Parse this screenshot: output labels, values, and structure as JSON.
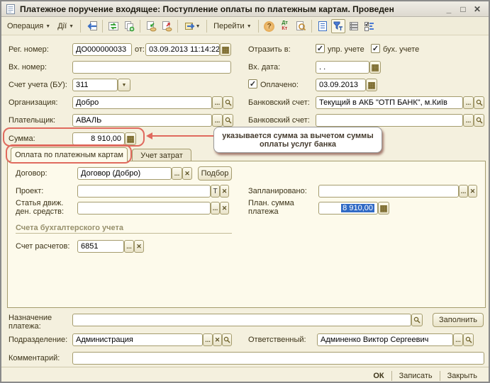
{
  "window": {
    "title": "Платежное поручение входящее: Поступление оплаты по платежным картам. Проведен",
    "minimize": "_",
    "maximize": "□",
    "close": "✕"
  },
  "toolbar": {
    "operation_label": "Операция",
    "actions_label": "Дії",
    "go_label": "Перейти",
    "dt": "Дт",
    "kt": "Кт",
    "help": "?"
  },
  "header": {
    "reg_number": {
      "label": "Рег. номер:",
      "value": "ДО000000033",
      "from_label": "от:",
      "date_value": "03.09.2013 11:14:22"
    },
    "in_number": {
      "label": "Вх. номер:",
      "value": ""
    },
    "account_bu": {
      "label": "Счет учета (БУ):",
      "value": "311"
    },
    "organization": {
      "label": "Организация:",
      "value": "Добро"
    },
    "payer": {
      "label": "Плательщик:",
      "value": "АВАЛЬ"
    },
    "amount": {
      "label": "Сумма:",
      "value": "8 910,00"
    },
    "reflect_in": {
      "label": "Отразить в:",
      "cb1_label": "упр. учете",
      "cb2_label": "бух. учете",
      "cb1_checked": true,
      "cb2_checked": true
    },
    "in_date": {
      "label": "Вх. дата:",
      "value": " .  . "
    },
    "paid": {
      "label": "Оплачено:",
      "value": "03.09.2013",
      "checked": true
    },
    "bank_account1": {
      "label": "Банковский счет:",
      "value": "Текущий в АКБ \"ОТП БАНК\", м.Київ"
    },
    "bank_account2": {
      "label": "Банковский счет:",
      "value": ""
    }
  },
  "tabs": {
    "active": "Оплата по платежным картам",
    "inactive": "Учет затрат"
  },
  "panel": {
    "contract": {
      "label": "Договор:",
      "value": "Договор (Добро)",
      "pick_button": "Подбор"
    },
    "project": {
      "label": "Проект:",
      "value": ""
    },
    "cashflow_item": {
      "label_line1": "Статья движ.",
      "label_line2": "ден. средств:",
      "value": ""
    },
    "planned": {
      "label": "Запланировано:",
      "value": ""
    },
    "planned_amount": {
      "label_line1": "План. сумма",
      "label_line2": "платежа",
      "value": "8 910,00"
    },
    "accounts_section_title": "Счета бухгалтерского учета",
    "settlement_account": {
      "label": "Счет расчетов:",
      "value": "6851"
    }
  },
  "bottom": {
    "payment_purpose": {
      "label_line1": "Назначение",
      "label_line2": "платежа:",
      "value": "",
      "fill_button": "Заполнить"
    },
    "department": {
      "label": "Подразделение:",
      "value": "Администрация"
    },
    "responsible": {
      "label": "Ответственный:",
      "value": "Админенко Виктор Сергеевич"
    },
    "comment": {
      "label": "Комментарий:",
      "value": ""
    }
  },
  "footer": {
    "ok": "ОК",
    "save": "Записать",
    "close": "Закрыть"
  },
  "callout": {
    "text": "указывается сумма за вычетом суммы оплаты услуг банка"
  },
  "icons": {
    "ellipsis": "...",
    "clear": "✕",
    "dropdown": "▼",
    "text_edit": "T",
    "calendar": "▦",
    "calculator": "▦",
    "check": "✓"
  },
  "colors": {
    "annotation_red": "#E06A5E",
    "form_bg": "#F4F0DE",
    "panel_bg": "#FDFAEB",
    "selection_blue": "#316AC5"
  }
}
